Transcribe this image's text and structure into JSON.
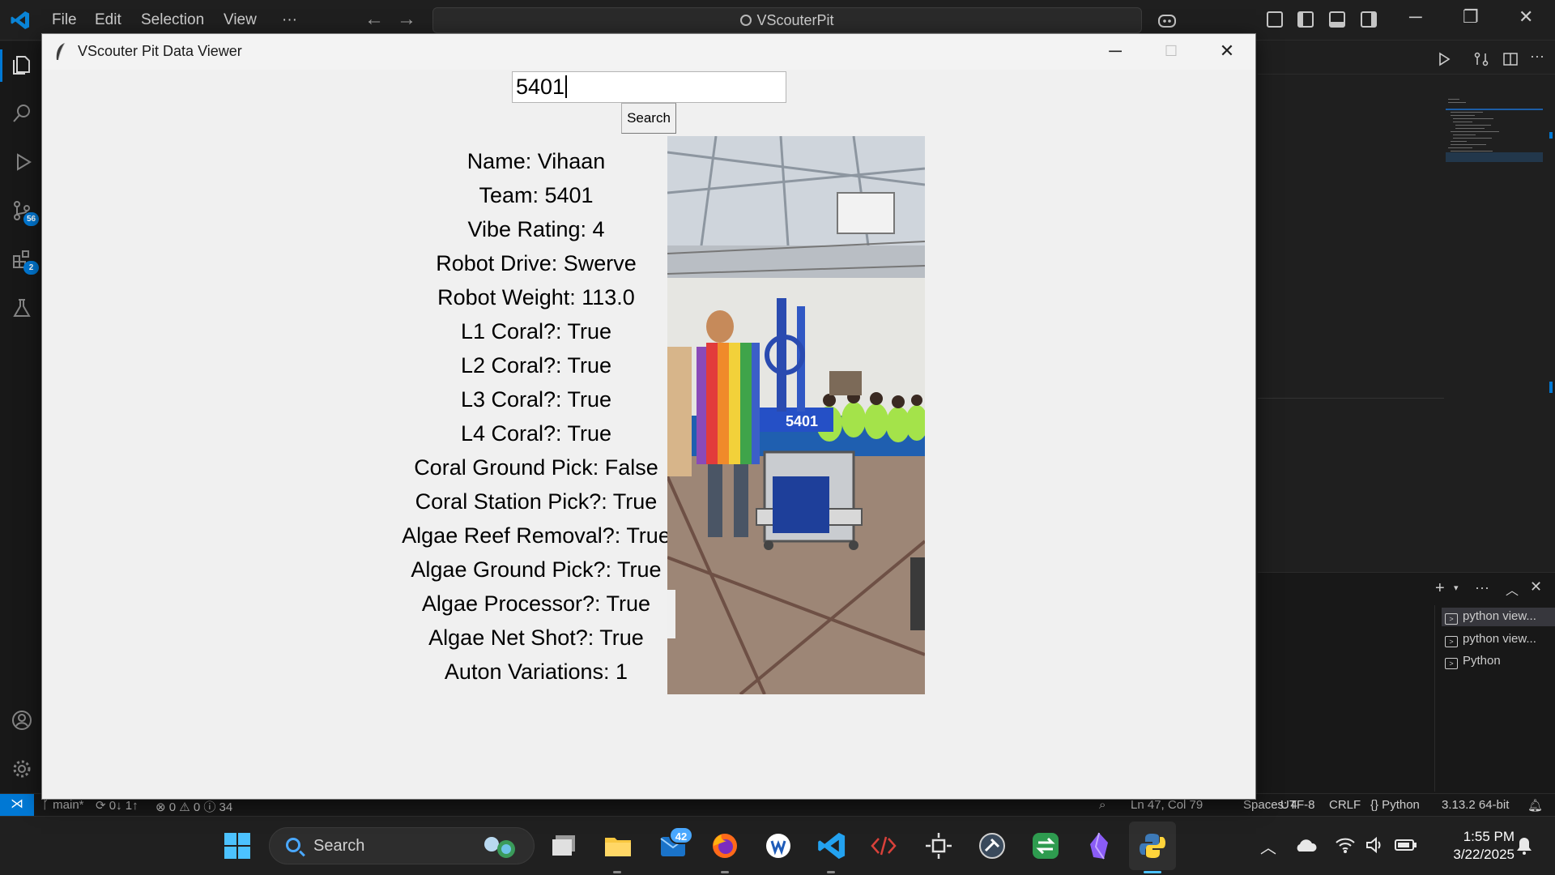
{
  "vscode": {
    "menu": [
      "File",
      "Edit",
      "Selection",
      "View",
      "···"
    ],
    "command_center": "VScouterPit",
    "activity_badges": {
      "source_control": "56",
      "extensions": "2"
    },
    "terminals": [
      "python view...",
      "python view...",
      "Python"
    ],
    "statusbar": {
      "branch": "main*",
      "sync": "0↓ 1↑",
      "problems": "⊗ 0 ⚠ 0 ⓘ 34",
      "position": "Ln 47, Col 79",
      "spaces": "Spaces: 4",
      "encoding": "UTF-8",
      "eol": "CRLF",
      "language": "{} Python",
      "interpreter": "3.13.2 64-bit"
    }
  },
  "taskbar": {
    "search_label": "Search",
    "notification_count": "42",
    "time": "1:55 PM",
    "date": "3/22/2025"
  },
  "window": {
    "title": "VScouter Pit Data Viewer"
  },
  "search": {
    "value": "5401",
    "button_label": "Search"
  },
  "record": {
    "fields": [
      "Name: Vihaan",
      "Team: 5401",
      "Vibe Rating: 4",
      "Robot Drive: Swerve",
      "Robot Weight: 113.0",
      "L1 Coral?: True",
      "L2 Coral?: True",
      "L3 Coral?: True",
      "L4 Coral?: True",
      "Coral Ground Pick: False",
      "Coral Station Pick?: True",
      "Algae Reef Removal?: True",
      "Algae Ground Pick?: True",
      "Algae Processor?: True",
      "Algae Net Shot?: True",
      "Auton Variations: 1"
    ],
    "photo_label": "5401"
  },
  "colors": {
    "vscode_bg": "#1f1f1f",
    "accent": "#0078d4",
    "window_bg": "#f0f0f0"
  }
}
